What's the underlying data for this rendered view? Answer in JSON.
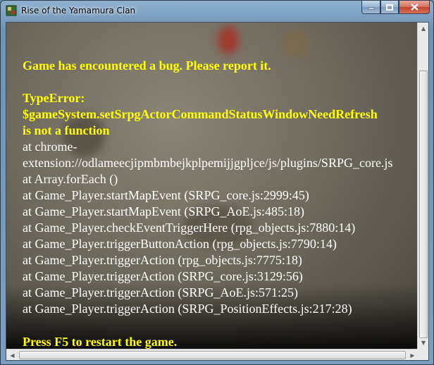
{
  "window": {
    "title": "Rise of the Yamamura Clan",
    "icon": "game-app-icon",
    "buttons": {
      "minimize": "minimize-icon",
      "maximize": "maximize-icon",
      "close": "close-icon"
    }
  },
  "error": {
    "header": "Game has encountered a bug. Please report it.",
    "type_line": "TypeError:",
    "message_line1": "$gameSystem.setSrpgActorCommandStatusWindowNeedRefresh",
    "message_line2": "is not a function",
    "stack": [
      "at chrome-",
      "extension://odlameecjipmbmbejkplpemijjgpljce/js/plugins/SRPG_core.js",
      "at Array.forEach ()",
      "at Game_Player.startMapEvent (SRPG_core.js:2999:45)",
      "at Game_Player.startMapEvent (SRPG_AoE.js:485:18)",
      "at Game_Player.checkEventTriggerHere (rpg_objects.js:7880:14)",
      "at Game_Player.triggerButtonAction (rpg_objects.js:7790:14)",
      "at Game_Player.triggerAction (rpg_objects.js:7775:18)",
      "at Game_Player.triggerAction (SRPG_core.js:3129:56)",
      "at Game_Player.triggerAction (SRPG_AoE.js:571:25)",
      "at Game_Player.triggerAction (SRPG_PositionEffects.js:217:28)"
    ],
    "restart": "Press F5 to restart the game."
  },
  "colors": {
    "accent_text": "#ffff00",
    "body_text": "#ffffff"
  }
}
